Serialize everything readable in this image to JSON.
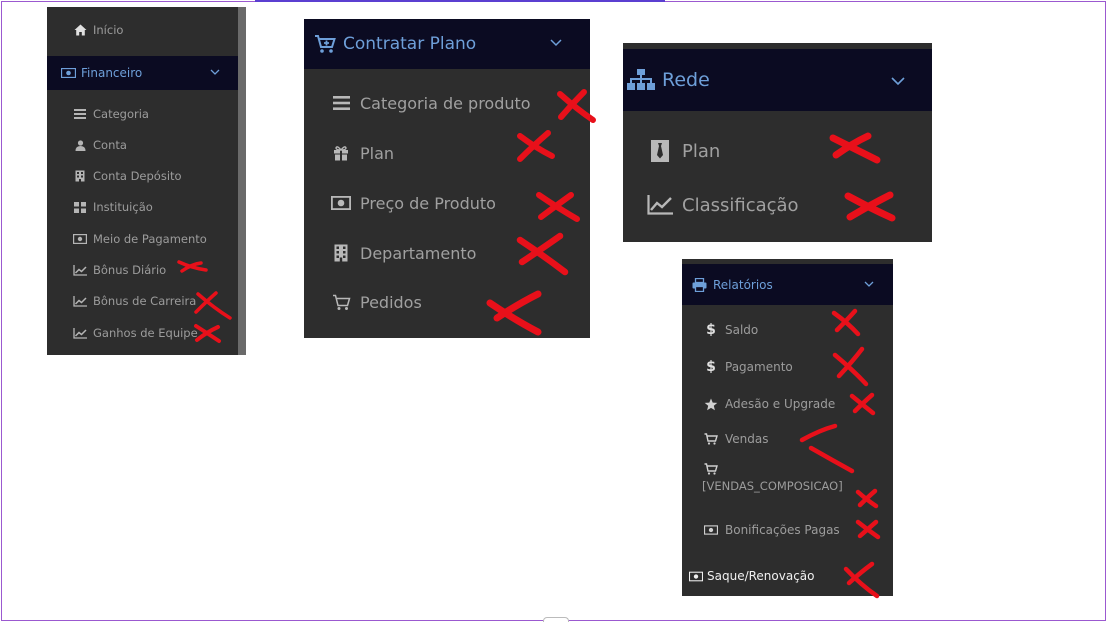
{
  "panel1": {
    "home_label": "Início",
    "header_label": "Financeiro",
    "items": [
      {
        "label": "Categoria",
        "icon": "bars-icon"
      },
      {
        "label": "Conta",
        "icon": "user-icon"
      },
      {
        "label": "Conta Depósito",
        "icon": "building-icon"
      },
      {
        "label": "Instituição",
        "icon": "grid-icon"
      },
      {
        "label": "Meio de Pagamento",
        "icon": "money-icon"
      },
      {
        "label": "Bônus Diário",
        "icon": "line-chart-icon"
      },
      {
        "label": "Bônus de Carreira",
        "icon": "line-chart-icon"
      },
      {
        "label": "Ganhos de Equipe",
        "icon": "line-chart-icon"
      }
    ]
  },
  "panel2": {
    "header_label": "Contratar Plano",
    "items": [
      {
        "label": "Categoria de produto",
        "icon": "bars-icon"
      },
      {
        "label": "Plan",
        "icon": "gift-icon"
      },
      {
        "label": "Preço de Produto",
        "icon": "money-icon"
      },
      {
        "label": "Departamento",
        "icon": "building-icon"
      },
      {
        "label": "Pedidos",
        "icon": "cart-icon"
      }
    ]
  },
  "panel3": {
    "header_label": "Rede",
    "items": [
      {
        "label": "Plan",
        "icon": "tie-icon"
      },
      {
        "label": "Classificação",
        "icon": "line-chart-icon"
      }
    ]
  },
  "panel4": {
    "header_label": "Relatórios",
    "items": [
      {
        "label": "Saldo",
        "icon": "dollar-icon"
      },
      {
        "label": "Pagamento",
        "icon": "dollar-icon"
      },
      {
        "label": "Adesão e Upgrade",
        "icon": "star-icon"
      },
      {
        "label": "Vendas",
        "icon": "cart-icon"
      },
      {
        "label": "[VENDAS_COMPOSICAO]",
        "icon": "cart-icon"
      },
      {
        "label": "Bonificações Pagas",
        "icon": "money-icon"
      }
    ],
    "footer_label": "Saque/Renovação"
  },
  "colors": {
    "panel_bg": "#2d2d2d",
    "header_bg": "#0b0b22",
    "header_text": "#6e9fd9",
    "item_text": "#a0a0a0",
    "x_mark": "#e8101a",
    "frame_border": "#9b59d0"
  }
}
